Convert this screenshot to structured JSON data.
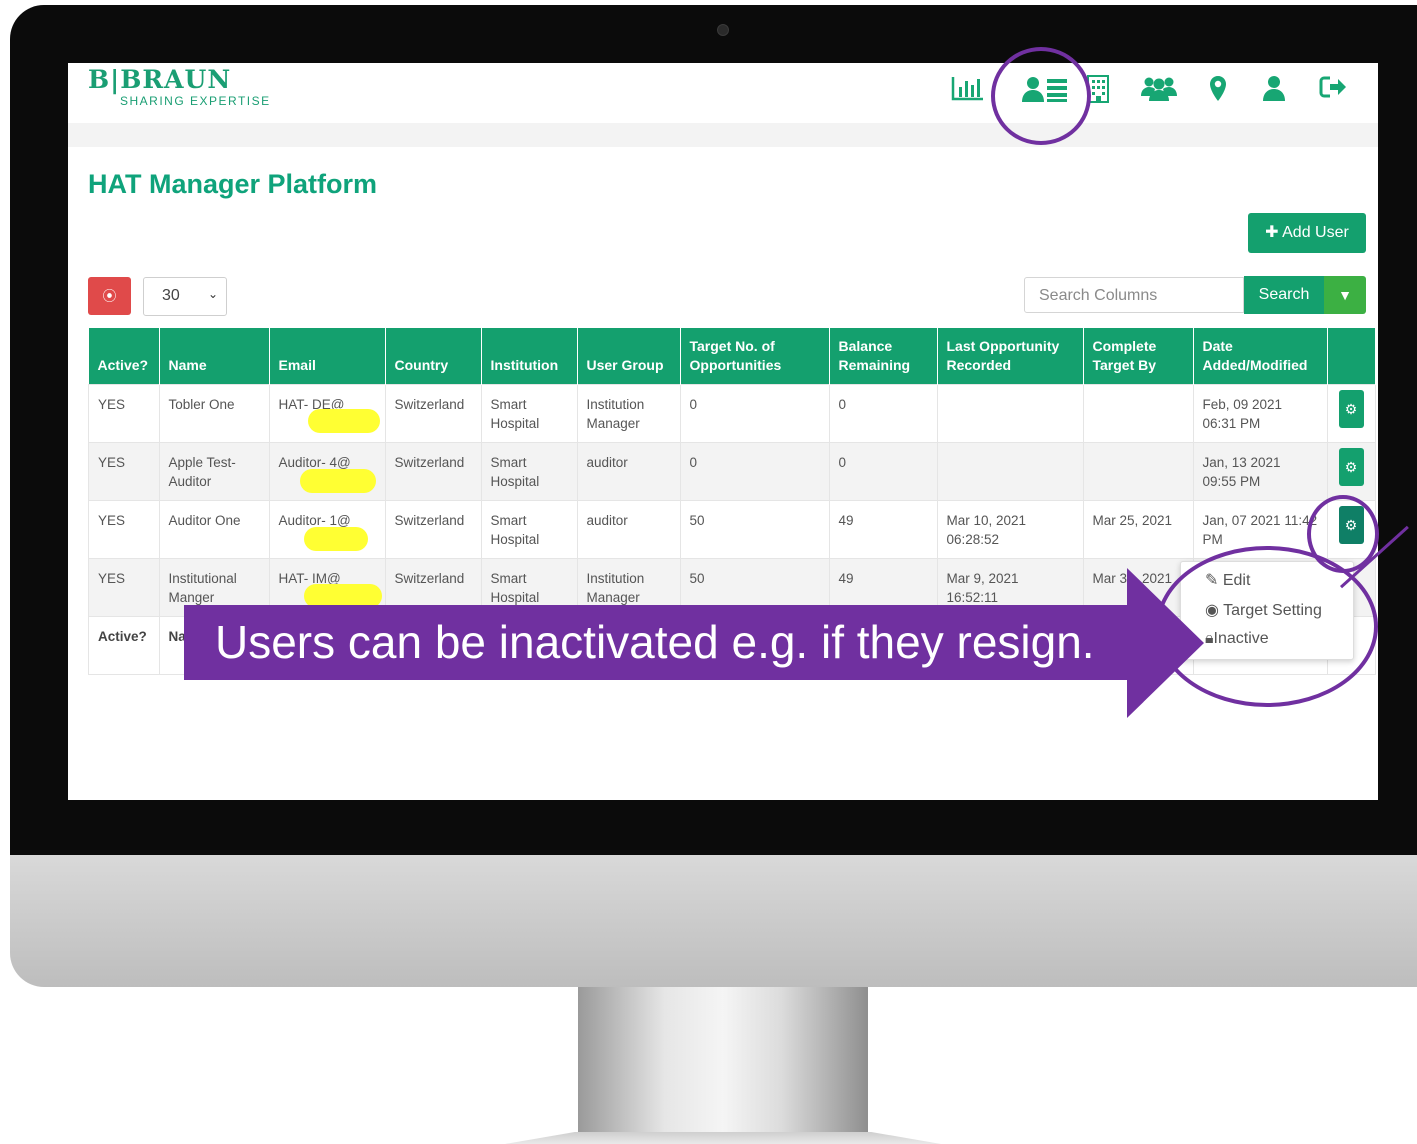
{
  "brand": {
    "logo": "B|BRAUN",
    "tagline": "SHARING EXPERTISE",
    "accent": "#14a06e"
  },
  "nav_icons": [
    "bar-chart-icon",
    "user-list-icon",
    "building-icon",
    "users-group-icon",
    "map-marker-icon",
    "user-icon",
    "sign-out-icon"
  ],
  "page": {
    "title": "HAT Manager Platform"
  },
  "toolbar": {
    "add_user": "Add User",
    "page_size": "30",
    "search_placeholder": "Search Columns",
    "search_button": "Search"
  },
  "table": {
    "headers": [
      "Active?",
      "Name",
      "Email",
      "Country",
      "Institution",
      "User Group",
      "Target No. of Opportunities",
      "Balance Remaining",
      "Last Opportunity Recorded",
      "Complete Target By",
      "Date Added/Modified"
    ],
    "rows": [
      {
        "active": "YES",
        "name": "Tobler One",
        "email": "HAT- DE@",
        "country": "Switzerland",
        "institution": "Smart Hospital",
        "group": "Institution Manager",
        "target": "0",
        "balance": "0",
        "last": "",
        "complete": "",
        "date": "Feb, 09 2021 06:31 PM"
      },
      {
        "active": "YES",
        "name": "Apple Test- Auditor",
        "email": "Auditor- 4@",
        "country": "Switzerland",
        "institution": "Smart Hospital",
        "group": "auditor",
        "target": "0",
        "balance": "0",
        "last": "",
        "complete": "",
        "date": "Jan, 13 2021 09:55 PM"
      },
      {
        "active": "YES",
        "name": "Auditor One",
        "email": "Auditor- 1@",
        "country": "Switzerland",
        "institution": "Smart Hospital",
        "group": "auditor",
        "target": "50",
        "balance": "49",
        "last": "Mar 10, 2021 06:28:52",
        "complete": "Mar 25, 2021",
        "date": "Jan, 07 2021 11:42 PM"
      },
      {
        "active": "YES",
        "name": "Institutional Manger",
        "email": "HAT- IM@",
        "country": "Switzerland",
        "institution": "Smart Hospital",
        "group": "Institution Manager",
        "target": "50",
        "balance": "49",
        "last": "Mar 9, 2021 16:52:11",
        "complete": "Mar 31, 2021",
        "date": ""
      }
    ],
    "footer": [
      "Active?",
      "Na"
    ]
  },
  "menu": {
    "edit": "Edit",
    "target": "Target Setting",
    "inactive": "Inactive"
  },
  "annotation": {
    "text": "Users can be inactivated e.g. if they resign.",
    "color": "#7030a0"
  }
}
